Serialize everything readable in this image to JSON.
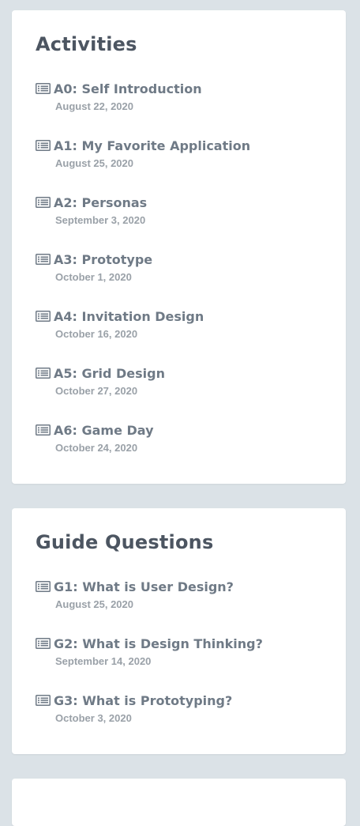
{
  "colors": {
    "page_background": "#dbe2e7",
    "card_background": "#ffffff",
    "heading": "#4c5561",
    "link": "#6f7a86",
    "date": "#9aa1a8"
  },
  "icon": "list-alt-icon",
  "activities": {
    "title": "Activities",
    "items": [
      {
        "title": "A0: Self Introduction",
        "date": "August 22, 2020"
      },
      {
        "title": "A1: My Favorite Application",
        "date": "August 25, 2020"
      },
      {
        "title": "A2: Personas",
        "date": "September 3, 2020"
      },
      {
        "title": "A3: Prototype",
        "date": "October 1, 2020"
      },
      {
        "title": "A4: Invitation Design",
        "date": "October 16, 2020"
      },
      {
        "title": "A5: Grid Design",
        "date": "October 27, 2020"
      },
      {
        "title": "A6: Game Day",
        "date": "October 24, 2020"
      }
    ]
  },
  "guide_questions": {
    "title": "Guide Questions",
    "items": [
      {
        "title": "G1: What is User Design?",
        "date": "August 25, 2020"
      },
      {
        "title": "G2: What is Design Thinking?",
        "date": "September 14, 2020"
      },
      {
        "title": "G3: What is Prototyping?",
        "date": "October 3, 2020"
      }
    ]
  }
}
